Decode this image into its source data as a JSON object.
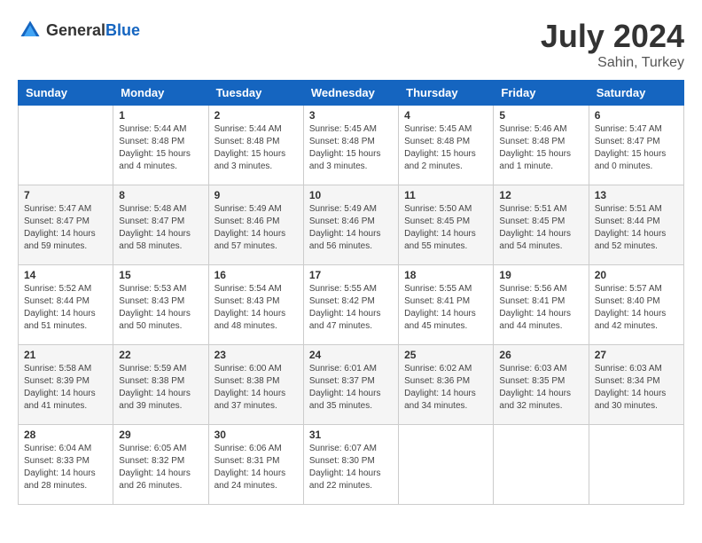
{
  "header": {
    "logo_general": "General",
    "logo_blue": "Blue",
    "month_year": "July 2024",
    "location": "Sahin, Turkey"
  },
  "days_of_week": [
    "Sunday",
    "Monday",
    "Tuesday",
    "Wednesday",
    "Thursday",
    "Friday",
    "Saturday"
  ],
  "weeks": [
    [
      {
        "day": "",
        "sunrise": "",
        "sunset": "",
        "daylight": ""
      },
      {
        "day": "1",
        "sunrise": "Sunrise: 5:44 AM",
        "sunset": "Sunset: 8:48 PM",
        "daylight": "Daylight: 15 hours and 4 minutes."
      },
      {
        "day": "2",
        "sunrise": "Sunrise: 5:44 AM",
        "sunset": "Sunset: 8:48 PM",
        "daylight": "Daylight: 15 hours and 3 minutes."
      },
      {
        "day": "3",
        "sunrise": "Sunrise: 5:45 AM",
        "sunset": "Sunset: 8:48 PM",
        "daylight": "Daylight: 15 hours and 3 minutes."
      },
      {
        "day": "4",
        "sunrise": "Sunrise: 5:45 AM",
        "sunset": "Sunset: 8:48 PM",
        "daylight": "Daylight: 15 hours and 2 minutes."
      },
      {
        "day": "5",
        "sunrise": "Sunrise: 5:46 AM",
        "sunset": "Sunset: 8:48 PM",
        "daylight": "Daylight: 15 hours and 1 minute."
      },
      {
        "day": "6",
        "sunrise": "Sunrise: 5:47 AM",
        "sunset": "Sunset: 8:47 PM",
        "daylight": "Daylight: 15 hours and 0 minutes."
      }
    ],
    [
      {
        "day": "7",
        "sunrise": "Sunrise: 5:47 AM",
        "sunset": "Sunset: 8:47 PM",
        "daylight": "Daylight: 14 hours and 59 minutes."
      },
      {
        "day": "8",
        "sunrise": "Sunrise: 5:48 AM",
        "sunset": "Sunset: 8:47 PM",
        "daylight": "Daylight: 14 hours and 58 minutes."
      },
      {
        "day": "9",
        "sunrise": "Sunrise: 5:49 AM",
        "sunset": "Sunset: 8:46 PM",
        "daylight": "Daylight: 14 hours and 57 minutes."
      },
      {
        "day": "10",
        "sunrise": "Sunrise: 5:49 AM",
        "sunset": "Sunset: 8:46 PM",
        "daylight": "Daylight: 14 hours and 56 minutes."
      },
      {
        "day": "11",
        "sunrise": "Sunrise: 5:50 AM",
        "sunset": "Sunset: 8:45 PM",
        "daylight": "Daylight: 14 hours and 55 minutes."
      },
      {
        "day": "12",
        "sunrise": "Sunrise: 5:51 AM",
        "sunset": "Sunset: 8:45 PM",
        "daylight": "Daylight: 14 hours and 54 minutes."
      },
      {
        "day": "13",
        "sunrise": "Sunrise: 5:51 AM",
        "sunset": "Sunset: 8:44 PM",
        "daylight": "Daylight: 14 hours and 52 minutes."
      }
    ],
    [
      {
        "day": "14",
        "sunrise": "Sunrise: 5:52 AM",
        "sunset": "Sunset: 8:44 PM",
        "daylight": "Daylight: 14 hours and 51 minutes."
      },
      {
        "day": "15",
        "sunrise": "Sunrise: 5:53 AM",
        "sunset": "Sunset: 8:43 PM",
        "daylight": "Daylight: 14 hours and 50 minutes."
      },
      {
        "day": "16",
        "sunrise": "Sunrise: 5:54 AM",
        "sunset": "Sunset: 8:43 PM",
        "daylight": "Daylight: 14 hours and 48 minutes."
      },
      {
        "day": "17",
        "sunrise": "Sunrise: 5:55 AM",
        "sunset": "Sunset: 8:42 PM",
        "daylight": "Daylight: 14 hours and 47 minutes."
      },
      {
        "day": "18",
        "sunrise": "Sunrise: 5:55 AM",
        "sunset": "Sunset: 8:41 PM",
        "daylight": "Daylight: 14 hours and 45 minutes."
      },
      {
        "day": "19",
        "sunrise": "Sunrise: 5:56 AM",
        "sunset": "Sunset: 8:41 PM",
        "daylight": "Daylight: 14 hours and 44 minutes."
      },
      {
        "day": "20",
        "sunrise": "Sunrise: 5:57 AM",
        "sunset": "Sunset: 8:40 PM",
        "daylight": "Daylight: 14 hours and 42 minutes."
      }
    ],
    [
      {
        "day": "21",
        "sunrise": "Sunrise: 5:58 AM",
        "sunset": "Sunset: 8:39 PM",
        "daylight": "Daylight: 14 hours and 41 minutes."
      },
      {
        "day": "22",
        "sunrise": "Sunrise: 5:59 AM",
        "sunset": "Sunset: 8:38 PM",
        "daylight": "Daylight: 14 hours and 39 minutes."
      },
      {
        "day": "23",
        "sunrise": "Sunrise: 6:00 AM",
        "sunset": "Sunset: 8:38 PM",
        "daylight": "Daylight: 14 hours and 37 minutes."
      },
      {
        "day": "24",
        "sunrise": "Sunrise: 6:01 AM",
        "sunset": "Sunset: 8:37 PM",
        "daylight": "Daylight: 14 hours and 35 minutes."
      },
      {
        "day": "25",
        "sunrise": "Sunrise: 6:02 AM",
        "sunset": "Sunset: 8:36 PM",
        "daylight": "Daylight: 14 hours and 34 minutes."
      },
      {
        "day": "26",
        "sunrise": "Sunrise: 6:03 AM",
        "sunset": "Sunset: 8:35 PM",
        "daylight": "Daylight: 14 hours and 32 minutes."
      },
      {
        "day": "27",
        "sunrise": "Sunrise: 6:03 AM",
        "sunset": "Sunset: 8:34 PM",
        "daylight": "Daylight: 14 hours and 30 minutes."
      }
    ],
    [
      {
        "day": "28",
        "sunrise": "Sunrise: 6:04 AM",
        "sunset": "Sunset: 8:33 PM",
        "daylight": "Daylight: 14 hours and 28 minutes."
      },
      {
        "day": "29",
        "sunrise": "Sunrise: 6:05 AM",
        "sunset": "Sunset: 8:32 PM",
        "daylight": "Daylight: 14 hours and 26 minutes."
      },
      {
        "day": "30",
        "sunrise": "Sunrise: 6:06 AM",
        "sunset": "Sunset: 8:31 PM",
        "daylight": "Daylight: 14 hours and 24 minutes."
      },
      {
        "day": "31",
        "sunrise": "Sunrise: 6:07 AM",
        "sunset": "Sunset: 8:30 PM",
        "daylight": "Daylight: 14 hours and 22 minutes."
      },
      {
        "day": "",
        "sunrise": "",
        "sunset": "",
        "daylight": ""
      },
      {
        "day": "",
        "sunrise": "",
        "sunset": "",
        "daylight": ""
      },
      {
        "day": "",
        "sunrise": "",
        "sunset": "",
        "daylight": ""
      }
    ]
  ]
}
